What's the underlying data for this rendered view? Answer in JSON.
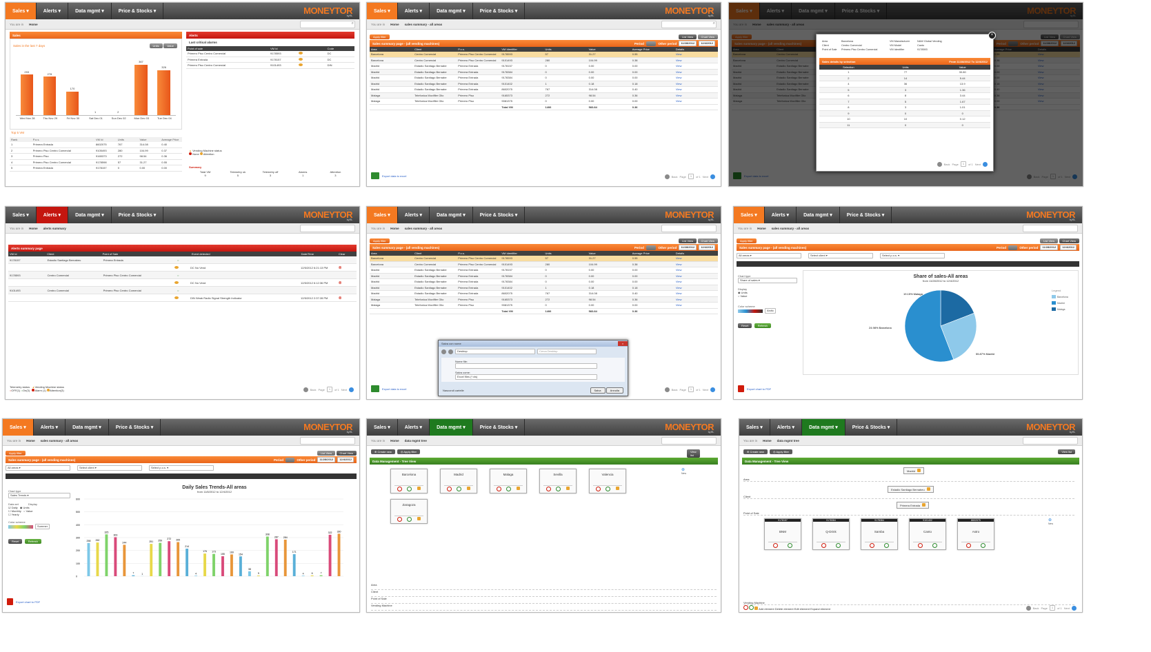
{
  "nav": {
    "sales": "Sales",
    "alerts": "Alerts",
    "data": "Data mgmt",
    "price": "Price & Stocks"
  },
  "logo": {
    "text": "MONEYTOR",
    "sub": "by EL"
  },
  "crumb": {
    "you_are_in": "You are in",
    "home": "Home",
    "sales_summary": "sales summary - all areas",
    "alerts_summary": "alerts summary",
    "data_mgmt_tree": "data mgmt tree"
  },
  "tile1": {
    "sales_title": "Sales",
    "sales_sub": "Sales in the last 7 days",
    "btn_units": "Units",
    "btn_value": "Value",
    "bars": [
      {
        "label": "Wed Nov 28",
        "v": 293
      },
      {
        "label": "Thu Nov 29",
        "v": 278
      },
      {
        "label": "Fri Nov 30",
        "v": 170
      },
      {
        "label": "Sat Dec 01",
        "v": 1
      },
      {
        "label": "Sun Dec 02",
        "v": 2
      },
      {
        "label": "Mon Dec 03",
        "v": 367
      },
      {
        "label": "Tue Dec 04",
        "v": 326
      }
    ],
    "top5": "Top 5 VM",
    "top5_head": [
      "Rank",
      "P.o.s.",
      "VM Id",
      "Units",
      "Value",
      "Average Price"
    ],
    "top5_rows": [
      [
        "1",
        "Primera Entrada",
        "8602075",
        "767",
        "314.08",
        "0.40"
      ],
      [
        "2",
        "Primero Piso Centro Comercial",
        "9105493",
        "280",
        "104.99",
        "0.37"
      ],
      [
        "3",
        "Primero Piso",
        "9165373",
        "272",
        "98.54",
        "0.36"
      ],
      [
        "4",
        "Primero Piso Centro Comercial",
        "9178598",
        "57",
        "31.27",
        "0.55"
      ],
      [
        "5",
        "Primera Entrada",
        "9178157",
        "0",
        "0.00",
        "0.00"
      ]
    ],
    "alerts_title": "Alerts",
    "alerts_sub": "Last critical alarms",
    "alerts_head": [
      "Point of sale",
      "VM Id",
      "",
      "Code"
    ],
    "alerts_rows": [
      [
        "Primero Piso Centro Comercial",
        "9178593",
        "DC"
      ],
      [
        "Primera Entrada",
        "9178157",
        "DC"
      ],
      [
        "Primero Piso Centro Comercial",
        "9101493",
        "DIN"
      ]
    ],
    "vending_status": "Vending Machine status",
    "none": "None",
    "attention": "Attention",
    "summary": "Summary",
    "summary_head": [
      "Total VM",
      "Telemetry ok",
      "Telemetry off",
      "Alarms",
      "Attention"
    ],
    "summary_vals": [
      "9",
      "5",
      "3",
      "1",
      "3"
    ]
  },
  "summary_table": {
    "apply": "Apply filter",
    "list_view": "List View",
    "chart_view": "Chart View",
    "title": "Sales summary page - (all vending machines)",
    "period": "Period",
    "other_period": "Other period",
    "date_from": "11/28/2012",
    "date_to": "12/4/2012",
    "head": [
      "Area",
      "Client",
      "P.o.s.",
      "VM Identifier",
      "Units",
      "Value",
      "Average Price",
      "Details"
    ],
    "rows": [
      [
        "Barcelona",
        "Centro Comercial",
        "Primero Piso Centro Comercial",
        "9178593",
        "57",
        "31.27",
        "0.55",
        "View"
      ],
      [
        "Barcelona",
        "Centro Comercial",
        "Primero Piso Centro Comercial",
        "9101493",
        "280",
        "104.99",
        "0.38",
        "View"
      ],
      [
        "Madrid",
        "Estadio Santiago Bernabe",
        "Primera Entrada",
        "9178157",
        "0",
        "0.00",
        "0.00",
        "View"
      ],
      [
        "Madrid",
        "Estadio Santiago Bernabe",
        "Primera Entrada",
        "9178384",
        "0",
        "0.00",
        "0.00",
        "View"
      ],
      [
        "Madrid",
        "Estadio Santiago Bernabe",
        "Primera Entrada",
        "9178384",
        "0",
        "0.00",
        "0.00",
        "View"
      ],
      [
        "Madrid",
        "Estadio Santiago Bernabe",
        "Primera Entrada",
        "9101402",
        "1",
        "0.18",
        "0.18",
        "View"
      ],
      [
        "Madrid",
        "Estadio Santiago Bernabe",
        "Primera Entrada",
        "8602075",
        "767",
        "314.08",
        "0.40",
        "View"
      ],
      [
        "Malaga",
        "Telefonica Movilfler Olio",
        "Primero Piso",
        "9165373",
        "272",
        "98.54",
        "0.36",
        "View"
      ],
      [
        "Malaga",
        "Telefonica Movilfler Olio",
        "Primero Piso",
        "9081375",
        "0",
        "0.00",
        "0.00",
        "View"
      ]
    ],
    "total_label": "Total VM",
    "total_units": "1406",
    "total_value": "583.84",
    "total_avg": "0.36",
    "export": "Export data to excel",
    "back": "Back",
    "page": "Page",
    "of": "of 1",
    "next": "Next"
  },
  "modal1": {
    "area_l": "Area",
    "area": "Barcelona",
    "client_l": "Client",
    "client": "Centro Comercial",
    "pos_l": "Point of Sale",
    "pos": "Primero Piso Centro Comercial",
    "vmm_l": "VM Manufacturer",
    "vmm": "N&W Global Vending",
    "vmmod_l": "VM Model",
    "vmmod": "Canto",
    "vmid_l": "VM Identifier",
    "vmid": "9178593",
    "bar_title": "Sales details by selection",
    "from": "From",
    "to": "To",
    "head": [
      "Selection",
      "Units",
      "Value"
    ],
    "rows": [
      [
        "1",
        "77",
        "30.80"
      ],
      [
        "2",
        "14",
        "5.44"
      ],
      [
        "4",
        "36",
        "13.9"
      ],
      [
        "5",
        "3",
        "1.36"
      ],
      [
        "6",
        "8",
        "3.44"
      ],
      [
        "7",
        "5",
        "1.67"
      ],
      [
        "8",
        "3",
        "1.01"
      ],
      [
        "9",
        "0",
        "0"
      ],
      [
        "10",
        "10",
        "0.12"
      ],
      [
        "11",
        "0",
        "0"
      ]
    ]
  },
  "tile4": {
    "title": "Alerts summary page",
    "head": [
      "VM Id",
      "Client",
      "Point of Sale",
      "",
      "Event detected",
      "Date/Time",
      "Clear"
    ],
    "groups": [
      {
        "vm": "9178157",
        "client": "Estadio Santiago Bernabeu",
        "pos": "Primera Entrada",
        "event": "DC  No Vend",
        "dt": "12/5/2012 6:21:13 PM"
      },
      {
        "vm": "9178593",
        "client": "Centro Comercial",
        "pos": "Primero Piso Centro Comercial",
        "event": "DC  No Vend",
        "dt": "12/5/2012 6:12:36 PM"
      },
      {
        "vm": "9101493",
        "client": "Centro Comercial",
        "pos": "Primero Piso Centro Comercial",
        "event": "DIN  Weak Radio Signal Strength Indicator",
        "dt": "12/5/2012 2:37:28 PM"
      }
    ],
    "legend_tel": "Telemetry status",
    "legend_vend": "Vending Machine status",
    "off": "OFF(1)",
    "on": "On(3)",
    "alarm": "Alarm (1)",
    "att": "Attention(3)"
  },
  "modal2": {
    "title": "Salva con nome",
    "path": "Desktop",
    "search": "Cerca Desktop",
    "name_l": "Nome file:",
    "type_l": "Salva come:",
    "type": "Excel files (*.xls)",
    "hide": "Nascondi cartelle",
    "save": "Salva",
    "cancel": "Annulla"
  },
  "pie": {
    "all_areas": "All areas",
    "select_client": "Select client",
    "select_pos": "Select p.o.s.",
    "chart_type": "Chart type",
    "share": "Share of sales",
    "display": "Display",
    "units": "Units",
    "value": "Value",
    "color_scheme": "Color scheme",
    "arctic": "Arctic",
    "reset": "Reset",
    "refresh": "Refresh",
    "export_pdf": "Export chart to PDF",
    "title": "Share of sales-All areas",
    "sub": "from 11/28/2012 to 12/4/2012",
    "legend": "Legend",
    "slices": [
      {
        "name": "Barcelona",
        "pct": 24.98,
        "color": "#8ec9ea"
      },
      {
        "name": "Madrid",
        "pct": 55.87,
        "color": "#2a8fcf"
      },
      {
        "name": "Malaga",
        "pct": 19.15,
        "color": "#1c6aa3"
      }
    ],
    "l_malaga": "19.15% Malaga",
    "l_barcelona": "24.98% Barcelona",
    "l_madrid": "55.87% Madrid"
  },
  "trend": {
    "chart_type": "Chart type",
    "sales_trends": "Sales Trends",
    "data_set": "Data set",
    "display": "Display",
    "daily": "Daily",
    "monthly": "Monthly",
    "yearly": "Yearly",
    "units": "Units",
    "value": "Value",
    "scheme": "Summer",
    "title": "Daily Sales Trends-All areas",
    "sub": "from 11/8/2012 to 12/4/2012",
    "values": [
      258,
      262,
      325,
      303,
      244,
      7,
      1,
      251,
      259,
      272,
      265,
      214,
      4,
      176,
      173,
      155,
      169,
      154,
      38,
      5,
      308,
      287,
      284,
      171,
      4,
      6,
      7,
      322,
      330
    ]
  },
  "tree1": {
    "create": "Create new",
    "apply": "Apply filter",
    "title": "Data Management - Tree View",
    "view_list": "View list",
    "cards": [
      "Barcelona",
      "Madrid",
      "Malaga",
      "Sevilla",
      "Valencia",
      "Zaragoza"
    ],
    "rows": [
      "Area",
      "Client",
      "Point of Sale",
      "Vending Machine"
    ]
  },
  "tree2": {
    "title": "Data Management - Tree View",
    "n_area": "Madrid",
    "n_client": "Estadio Santiago Bernabeu",
    "n_pos": "Primera Entrada",
    "rows": [
      "Area",
      "Client",
      "Point of Sale",
      "Vending Machine"
    ],
    "vms": [
      {
        "id": "9178157",
        "name": "BNM"
      },
      {
        "id": "9178384",
        "name": "Q-Drink"
      },
      {
        "id": "9178384",
        "name": "Samba"
      },
      {
        "id": "9101402",
        "name": "Canto"
      },
      {
        "id": "8602075",
        "name": "Astro"
      }
    ],
    "legend": "Add element  Delete element  Edit element  Expand element",
    "new": "New"
  }
}
